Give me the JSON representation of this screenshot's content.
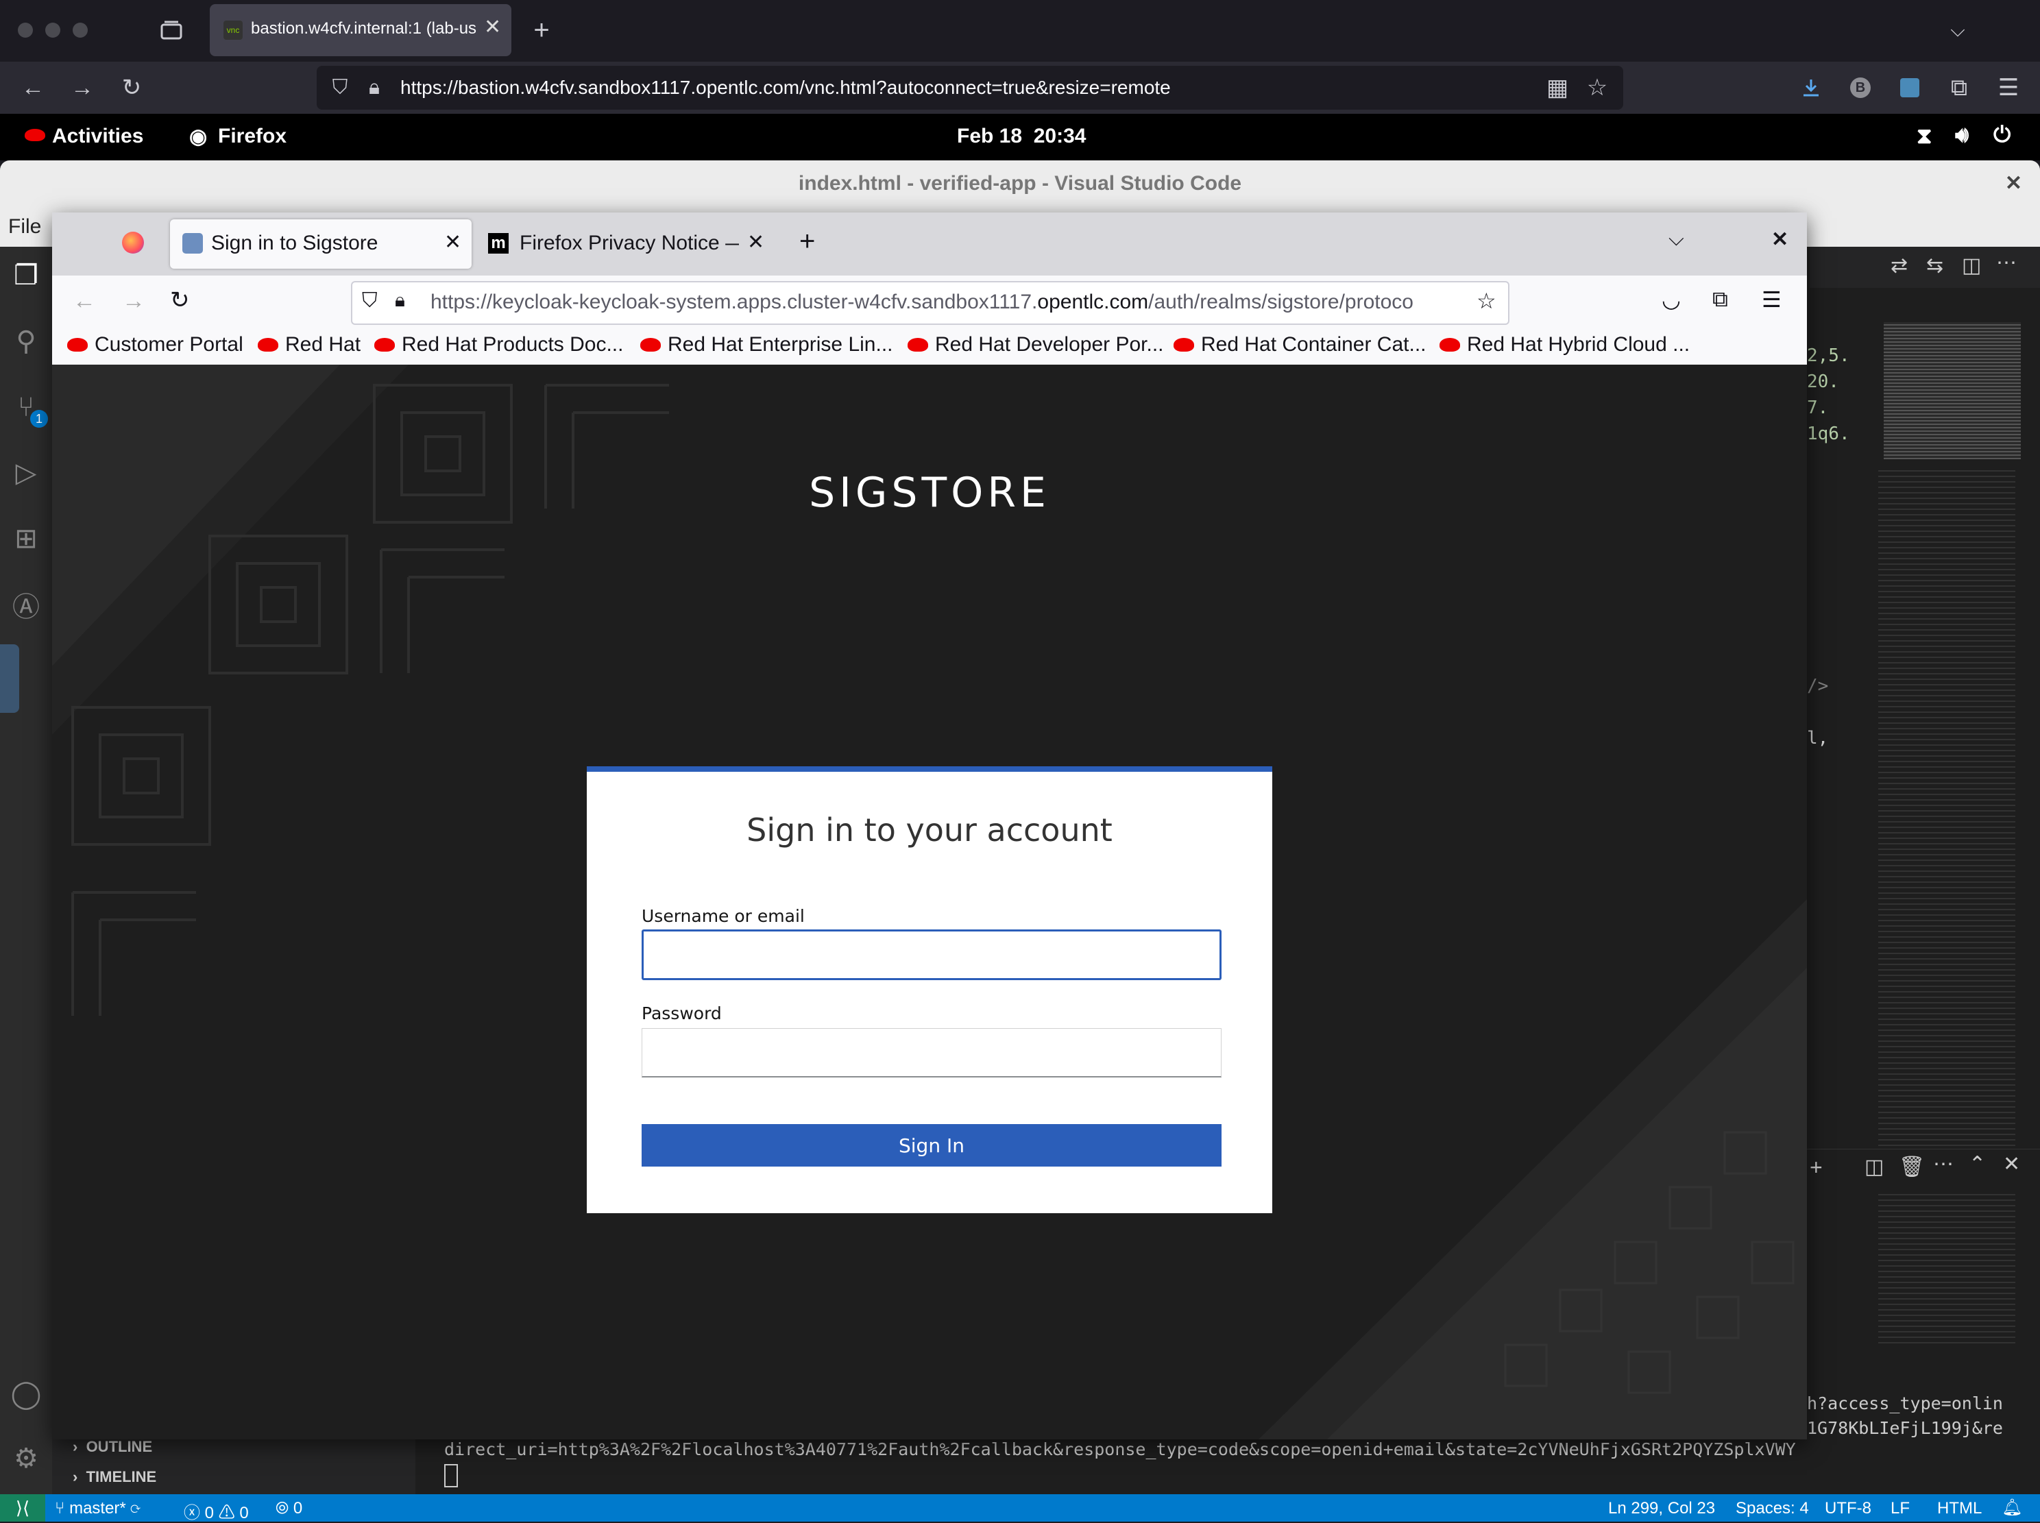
{
  "outer_browser": {
    "tab_title": "bastion.w4cfv.internal:1 (lab-us",
    "url": "https://bastion.w4cfv.sandbox1117.opentlc.com/vnc.html?autoconnect=true&resize=remote"
  },
  "gnome": {
    "activities": "Activities",
    "app": "Firefox",
    "datetime": "Feb 18  20:34"
  },
  "vscode": {
    "title": "index.html - verified-app - Visual Studio Code",
    "menu_file": "File",
    "sidebar_outline": "OUTLINE",
    "sidebar_timeline": "TIMELINE",
    "terminal_line1": "h?access_type=onlin",
    "terminal_line2": "1G78KbLIeFjL199j&re",
    "terminal_line3": "direct_uri=http%3A%2F%2Flocalhost%3A40771%2Fauth%2Fcallback&response_type=code&scope=openid+email&state=2cYVNeUhFjxGSRt2PQYZSplxVWY",
    "editor_snippets": [
      "2,5.",
      "20.",
      "7.",
      "1q6.",
      "/>",
      "l,"
    ],
    "source_control_badge": "1",
    "status": {
      "branch": "master*",
      "errors": "0",
      "warnings": "0",
      "ports": "0",
      "position": "Ln 299, Col 23",
      "spaces": "Spaces: 4",
      "encoding": "UTF-8",
      "eol": "LF",
      "language": "HTML"
    }
  },
  "inner_browser": {
    "active_tab": "Sign in to Sigstore",
    "second_tab": "Firefox Privacy Notice — I",
    "url_prefix": "https://keycloak-keycloak-system.apps.cluster-w4cfv.sandbox1117.",
    "url_domain": "opentlc.com",
    "url_suffix": "/auth/realms/sigstore/protoco",
    "bookmarks": [
      "Customer Portal",
      "Red Hat",
      "Red Hat Products Doc...",
      "Red Hat Enterprise Lin...",
      "Red Hat Developer Por...",
      "Red Hat Container Cat...",
      "Red Hat Hybrid Cloud ..."
    ]
  },
  "login": {
    "brand": "SIGSTORE",
    "heading": "Sign in to your account",
    "username_label": "Username or email",
    "username_value": "",
    "password_label": "Password",
    "password_value": "",
    "submit": "Sign In"
  },
  "colors": {
    "primary_blue": "#2b5eb9",
    "vscode_status": "#007acc",
    "page_background": "#1e1e1e"
  }
}
